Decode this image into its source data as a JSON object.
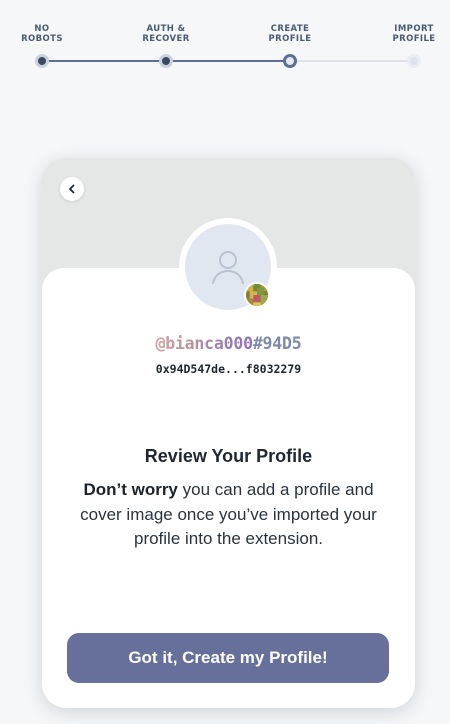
{
  "stepper": {
    "steps": [
      {
        "label": "NO\nROBOTS",
        "state": "done"
      },
      {
        "label": "AUTH &\nRECOVER",
        "state": "done"
      },
      {
        "label": "CREATE\nPROFILE",
        "state": "current"
      },
      {
        "label": "IMPORT\nPROFILE",
        "state": "future"
      }
    ]
  },
  "card": {
    "back_icon": "chevron-left-icon",
    "avatar_icon": "user-placeholder-icon",
    "handle_name": "@bianca000",
    "handle_tag": "#94D5",
    "address": "0x94D547de...f8032279",
    "title": "Review Your Profile",
    "desc_bold": "Don’t worry",
    "desc_rest": " you can add a profile and cover image once you’ve imported your profile into the extension.",
    "cta_label": "Got it, Create my Profile!"
  },
  "colors": {
    "accent": "#676f9b",
    "step_done": "#5c6d96",
    "background": "#f5f7f9"
  }
}
